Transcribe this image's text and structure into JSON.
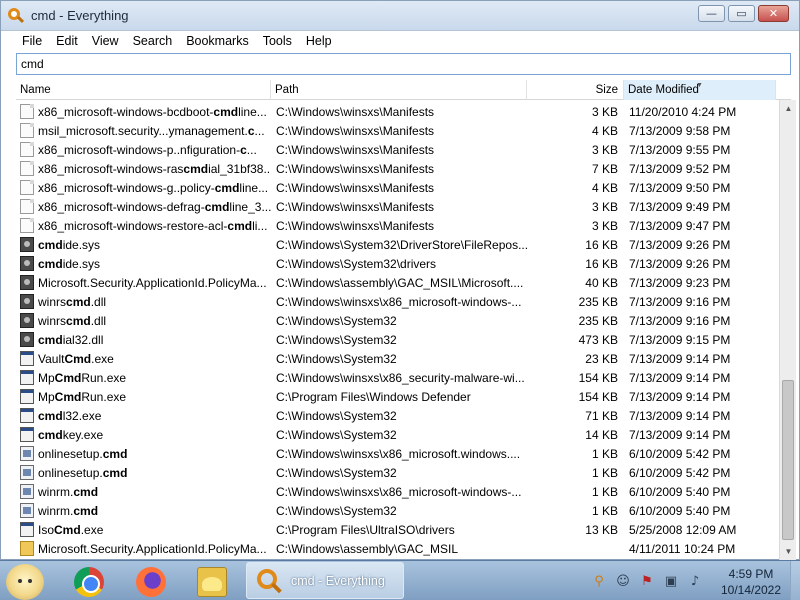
{
  "window": {
    "title": "cmd - Everything"
  },
  "window_buttons": {
    "minimize": "—",
    "maximize": "▭",
    "close": "✕"
  },
  "menu": [
    "File",
    "Edit",
    "View",
    "Search",
    "Bookmarks",
    "Tools",
    "Help"
  ],
  "search": {
    "value": "cmd"
  },
  "columns": {
    "name": "Name",
    "path": "Path",
    "size": "Size",
    "date": "Date Modified",
    "sorted_by": "Date Modified",
    "sort_direction": "descending"
  },
  "rows": [
    {
      "icon": "doc",
      "pre": "x86_microsoft-windows-bcdboot-",
      "bold": "cmd",
      "post": "line...",
      "path": "C:\\Windows\\winsxs\\Manifests",
      "size": "3 KB",
      "date": "11/20/2010 4:24 PM"
    },
    {
      "icon": "doc",
      "pre": "msil_microsoft.security...ymanagement.",
      "bold": "c",
      "post": "...",
      "path": "C:\\Windows\\winsxs\\Manifests",
      "size": "4 KB",
      "date": "7/13/2009 9:58 PM"
    },
    {
      "icon": "doc",
      "pre": "x86_microsoft-windows-p..nfiguration-",
      "bold": "c",
      "post": "...",
      "path": "C:\\Windows\\winsxs\\Manifests",
      "size": "3 KB",
      "date": "7/13/2009 9:55 PM"
    },
    {
      "icon": "doc",
      "pre": "x86_microsoft-windows-ras",
      "bold": "cmd",
      "post": "ial_31bf38...",
      "path": "C:\\Windows\\winsxs\\Manifests",
      "size": "7 KB",
      "date": "7/13/2009 9:52 PM"
    },
    {
      "icon": "doc",
      "pre": "x86_microsoft-windows-g..policy-",
      "bold": "cmd",
      "post": "line...",
      "path": "C:\\Windows\\winsxs\\Manifests",
      "size": "4 KB",
      "date": "7/13/2009 9:50 PM"
    },
    {
      "icon": "doc",
      "pre": "x86_microsoft-windows-defrag-",
      "bold": "cmd",
      "post": "line_3...",
      "path": "C:\\Windows\\winsxs\\Manifests",
      "size": "3 KB",
      "date": "7/13/2009 9:49 PM"
    },
    {
      "icon": "doc",
      "pre": "x86_microsoft-windows-restore-acl-",
      "bold": "cmd",
      "post": "li...",
      "path": "C:\\Windows\\winsxs\\Manifests",
      "size": "3 KB",
      "date": "7/13/2009 9:47 PM"
    },
    {
      "icon": "gear",
      "pre": "",
      "bold": "cmd",
      "post": "ide.sys",
      "path": "C:\\Windows\\System32\\DriverStore\\FileRepos...",
      "size": "16 KB",
      "date": "7/13/2009 9:26 PM"
    },
    {
      "icon": "gear",
      "pre": "",
      "bold": "cmd",
      "post": "ide.sys",
      "path": "C:\\Windows\\System32\\drivers",
      "size": "16 KB",
      "date": "7/13/2009 9:26 PM"
    },
    {
      "icon": "gear",
      "pre": "Microsoft.Security.ApplicationId.PolicyMa...",
      "bold": "",
      "post": "",
      "path": "C:\\Windows\\assembly\\GAC_MSIL\\Microsoft....",
      "size": "40 KB",
      "date": "7/13/2009 9:23 PM"
    },
    {
      "icon": "gear",
      "pre": "winrs",
      "bold": "cmd",
      "post": ".dll",
      "path": "C:\\Windows\\winsxs\\x86_microsoft-windows-...",
      "size": "235 KB",
      "date": "7/13/2009 9:16 PM"
    },
    {
      "icon": "gear",
      "pre": "winrs",
      "bold": "cmd",
      "post": ".dll",
      "path": "C:\\Windows\\System32",
      "size": "235 KB",
      "date": "7/13/2009 9:16 PM"
    },
    {
      "icon": "gear",
      "pre": "",
      "bold": "cmd",
      "post": "ial32.dll",
      "path": "C:\\Windows\\System32",
      "size": "473 KB",
      "date": "7/13/2009 9:15 PM"
    },
    {
      "icon": "exe",
      "pre": "Vault",
      "bold": "Cmd",
      "post": ".exe",
      "path": "C:\\Windows\\System32",
      "size": "23 KB",
      "date": "7/13/2009 9:14 PM"
    },
    {
      "icon": "exe",
      "pre": "Mp",
      "bold": "Cmd",
      "post": "Run.exe",
      "path": "C:\\Windows\\winsxs\\x86_security-malware-wi...",
      "size": "154 KB",
      "date": "7/13/2009 9:14 PM"
    },
    {
      "icon": "exe",
      "pre": "Mp",
      "bold": "Cmd",
      "post": "Run.exe",
      "path": "C:\\Program Files\\Windows Defender",
      "size": "154 KB",
      "date": "7/13/2009 9:14 PM"
    },
    {
      "icon": "exe",
      "pre": "",
      "bold": "cmd",
      "post": "l32.exe",
      "path": "C:\\Windows\\System32",
      "size": "71 KB",
      "date": "7/13/2009 9:14 PM"
    },
    {
      "icon": "exe",
      "pre": "",
      "bold": "cmd",
      "post": "key.exe",
      "path": "C:\\Windows\\System32",
      "size": "14 KB",
      "date": "7/13/2009 9:14 PM"
    },
    {
      "icon": "script",
      "pre": "onlinesetup.",
      "bold": "cmd",
      "post": "",
      "path": "C:\\Windows\\winsxs\\x86_microsoft.windows....",
      "size": "1 KB",
      "date": "6/10/2009 5:42 PM"
    },
    {
      "icon": "script",
      "pre": "onlinesetup.",
      "bold": "cmd",
      "post": "",
      "path": "C:\\Windows\\System32",
      "size": "1 KB",
      "date": "6/10/2009 5:42 PM"
    },
    {
      "icon": "script",
      "pre": "winrm.",
      "bold": "cmd",
      "post": "",
      "path": "C:\\Windows\\winsxs\\x86_microsoft-windows-...",
      "size": "1 KB",
      "date": "6/10/2009 5:40 PM"
    },
    {
      "icon": "script",
      "pre": "winrm.",
      "bold": "cmd",
      "post": "",
      "path": "C:\\Windows\\System32",
      "size": "1 KB",
      "date": "6/10/2009 5:40 PM"
    },
    {
      "icon": "exe",
      "pre": "Iso",
      "bold": "Cmd",
      "post": ".exe",
      "path": "C:\\Program Files\\UltraISO\\drivers",
      "size": "13 KB",
      "date": "5/25/2008 12:09 AM"
    },
    {
      "icon": "folder",
      "pre": "Microsoft.Security.ApplicationId.PolicyMa...",
      "bold": "",
      "post": "",
      "path": "C:\\Windows\\assembly\\GAC_MSIL",
      "size": "",
      "date": "4/11/2011 10:24 PM"
    }
  ],
  "taskbar": {
    "pinned": [
      "chrome-icon",
      "firefox-icon",
      "file-explorer-icon"
    ],
    "active_task": "cmd - Everything",
    "clock_time": "4:59 PM",
    "clock_date": "10/14/2022"
  },
  "tray_icons": [
    "everything-tray-icon",
    "chat-tray-icon",
    "flag-tray-icon",
    "network-tray-icon",
    "volume-tray-icon"
  ]
}
